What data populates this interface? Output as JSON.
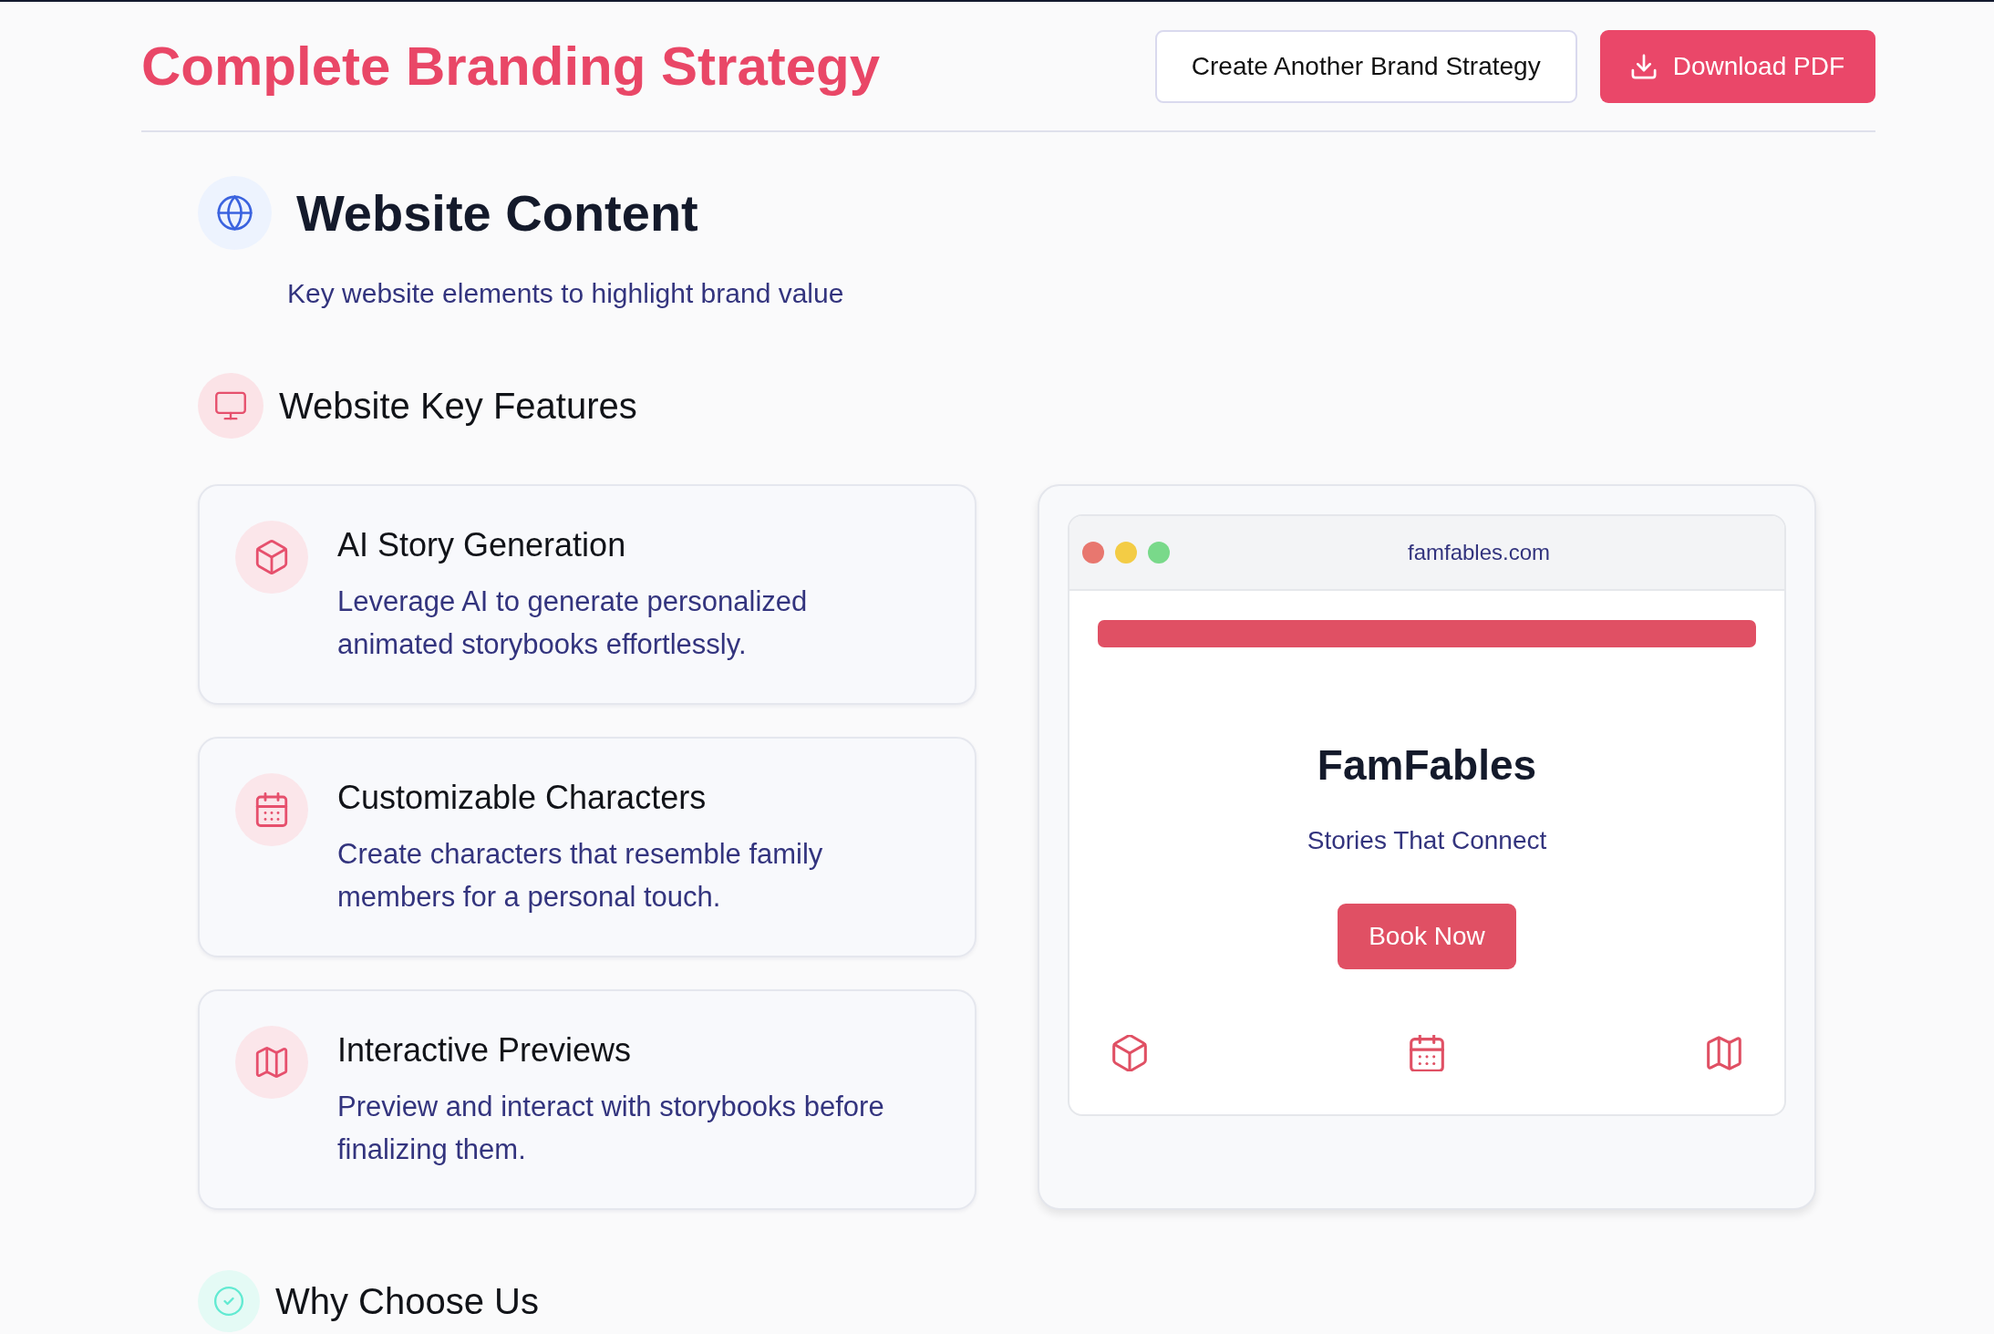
{
  "header": {
    "title": "Complete Branding Strategy",
    "buttons": [
      {
        "label": "Create Another Brand Strategy",
        "kind": "outline"
      },
      {
        "label": "Download PDF",
        "kind": "download"
      }
    ]
  },
  "section": {
    "title": "Website Content",
    "subtitle": "Key website elements to highlight brand value"
  },
  "key_features": {
    "title": "Website Key Features",
    "items": [
      {
        "title": "AI Story Generation",
        "description": "Leverage AI to generate personalized animated storybooks effortlessly."
      },
      {
        "title": "Customizable Characters",
        "description": "Create characters that resemble family members for a personal touch."
      },
      {
        "title": "Interactive Previews",
        "description": "Preview and interact with storybooks before finalizing them."
      }
    ]
  },
  "website_preview": {
    "url": "famfables.com",
    "brand_name": "FamFables",
    "tagline": "Stories That Connect",
    "cta_button": "Book Now"
  },
  "next_section": {
    "title": "Why Choose Us"
  }
}
